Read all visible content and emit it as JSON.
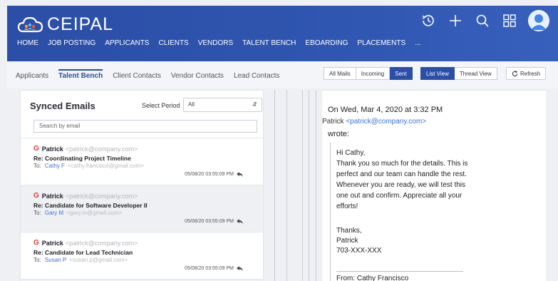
{
  "header": {
    "brand": "CEIPAL",
    "nav": [
      "HOME",
      "JOB POSTING",
      "APPLICANTS",
      "CLIENTS",
      "VENDORS",
      "TALENT BENCH",
      "EBOARDING",
      "PLACEMENTS",
      "..."
    ]
  },
  "subtabs": [
    "Applicants",
    "Talent Bench",
    "Client Contacts",
    "Vendor Contacts",
    "Lead Contacts"
  ],
  "filters": {
    "all": "All Mails",
    "incoming": "Incoming",
    "sent": "Sent"
  },
  "views": {
    "list": "List View",
    "thread": "Thread View"
  },
  "refresh": "Refresh",
  "panel": {
    "title": "Synced Emails",
    "period_label": "Select Period",
    "period_value": "All",
    "search_placeholder": "Search by email"
  },
  "emails": [
    {
      "sender": "Patrick",
      "sender_addr": "<patrick@company.com>",
      "subject": "Re: Coordinating Project Timeline",
      "to_label": "To:",
      "to_name": "Cathy F",
      "to_addr": "<cathy.francisco@gmail.com>",
      "time": "05/08/20 03:55:09 PM"
    },
    {
      "sender": "Patrick",
      "sender_addr": "<patrick@company.com>",
      "subject": "Re: Candidate for Software Developer II",
      "to_label": "To:",
      "to_name": "Gary M",
      "to_addr": "<gary.m@gmail.com>",
      "time": "05/08/20 03:55:09 PM"
    },
    {
      "sender": "Patrick",
      "sender_addr": "<patrick@company.com>",
      "subject": "Re: Candidate for Lead Technician",
      "to_label": "To:",
      "to_name": "Susan P",
      "to_addr": "<susan.p@gmail.com>",
      "time": "05/08/20 03:55:09 PM"
    }
  ],
  "message": {
    "line1": "On Wed, Mar 4, 2020 at 3:32 PM",
    "from_name": "Patrick",
    "from_addr": "<patrick@company.com>",
    "line3": "wrote:",
    "greeting": "Hi Cathy,",
    "body": "Thank you so much for the details. This is perfect and our team can handle the rest. Whenever you are ready, we will test this one out and confirm. Appreciate all your efforts!",
    "sig1": "Thanks,",
    "sig2": "Patrick",
    "sig3": "703-XXX-XXX",
    "from2": "From: Cathy Francisco"
  },
  "colors": {
    "brand": "#2b4ea6",
    "link": "#3a73d8"
  }
}
